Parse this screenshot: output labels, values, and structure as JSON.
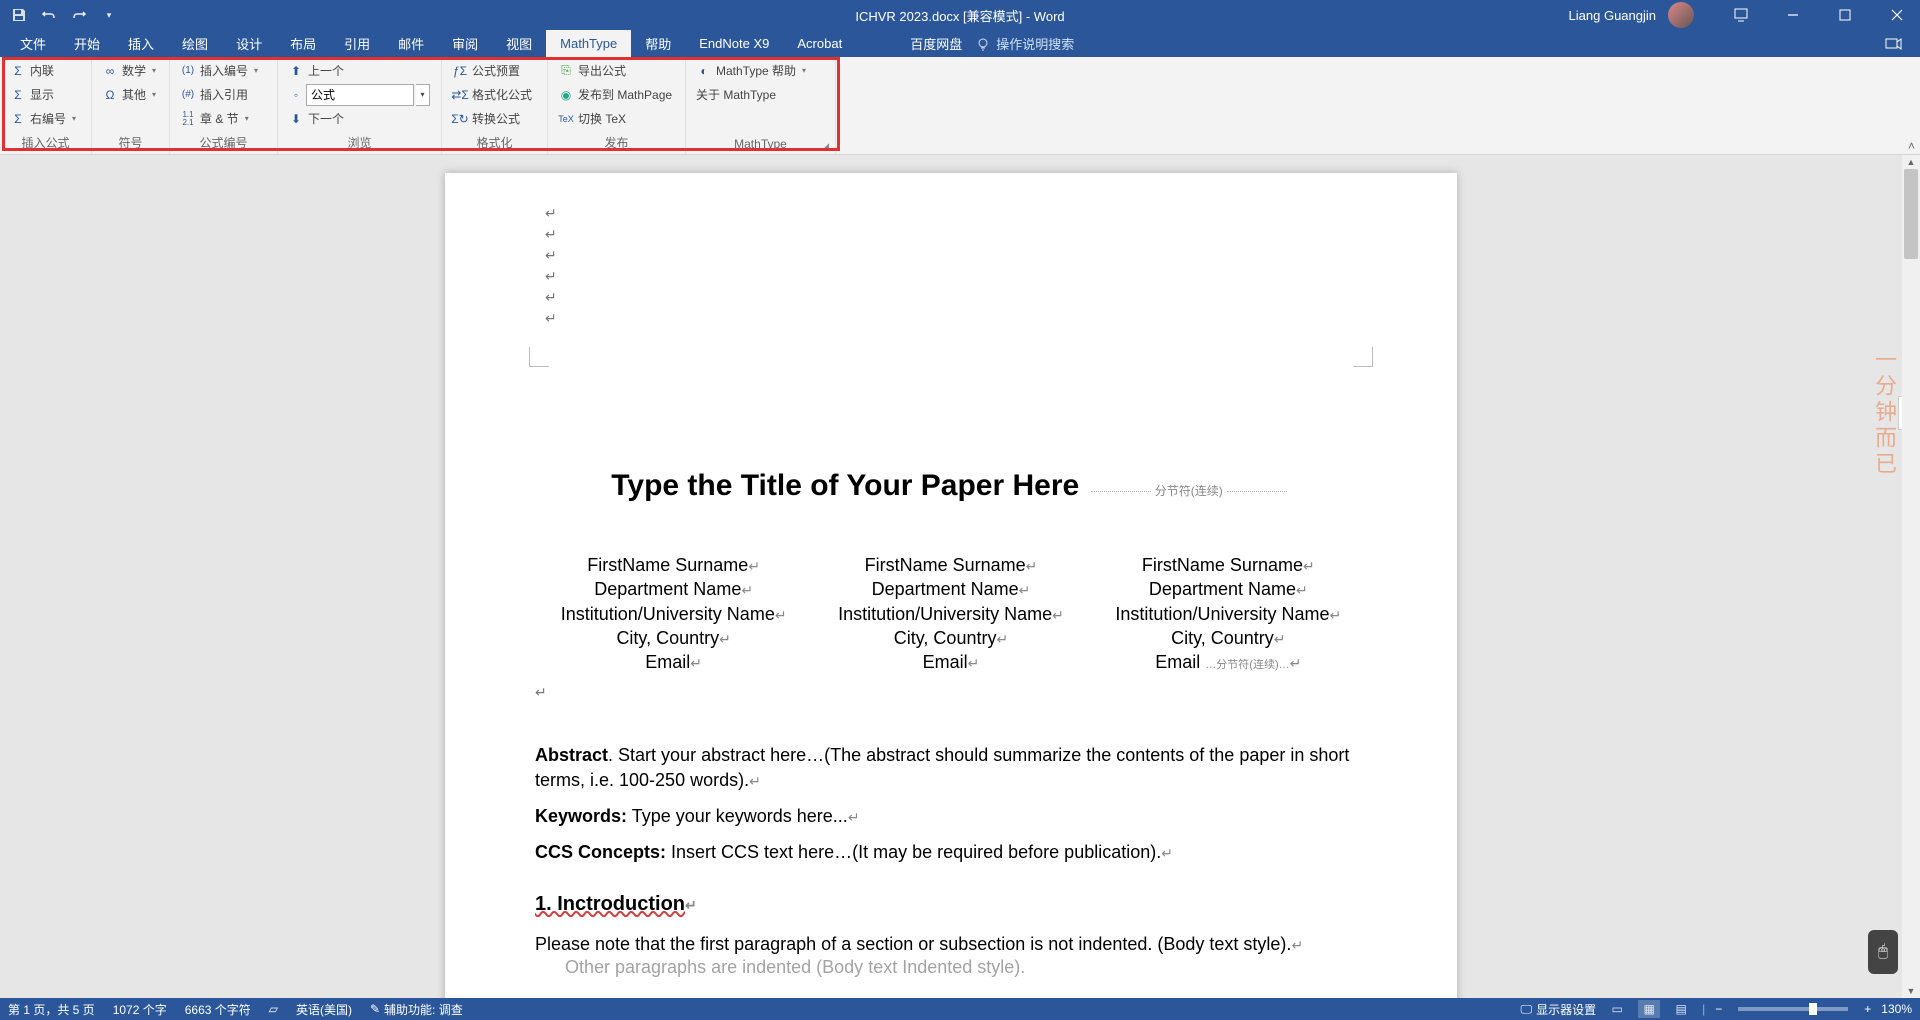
{
  "titlebar": {
    "doc_title": "ICHVR 2023.docx [兼容模式] - Word",
    "user": "Liang Guangjin"
  },
  "tabs": {
    "file": "文件",
    "home": "开始",
    "insert": "插入",
    "draw": "绘图",
    "design": "设计",
    "layout": "布局",
    "references": "引用",
    "mail": "邮件",
    "review": "审阅",
    "view": "视图",
    "mathtype": "MathType",
    "help": "帮助",
    "endnote": "EndNote X9",
    "acrobat": "Acrobat",
    "baidu": "百度网盘",
    "tell_me": "操作说明搜索"
  },
  "ribbon": {
    "g1": {
      "label": "插入公式",
      "inline": "内联",
      "display": "显示",
      "right_num": "右编号"
    },
    "g2": {
      "label": "符号",
      "math": "数学",
      "other": "其他"
    },
    "g3": {
      "label": "公式编号",
      "insert_num": "插入编号",
      "insert_ref": "插入引用",
      "chap_sec": "章 & 节"
    },
    "g4": {
      "label": "浏览",
      "prev": "上一个",
      "formula_value": "公式",
      "next": "下一个"
    },
    "g5": {
      "label": "格式化",
      "preset": "公式预置",
      "format": "格式化公式",
      "convert": "转换公式"
    },
    "g6": {
      "label": "发布",
      "export": "导出公式",
      "mathpage": "发布到 MathPage",
      "tex": "切换 TeX"
    },
    "g7": {
      "label": "MathType",
      "help": "MathType 帮助",
      "about": "关于 MathType"
    }
  },
  "document": {
    "title": "Type the Title of Your Paper Here",
    "section_break": "分节符(连续)",
    "author1": "FirstName Surname",
    "dept": "Department Name",
    "inst": "Institution/University Name",
    "city": "City, Country",
    "email": "Email",
    "abstract_label": "Abstract",
    "abstract_text": ". Start your abstract here…(The abstract should summarize the contents of the paper in short terms, i.e. 100-250 words).",
    "keywords_label": "Keywords:",
    "keywords_text": " Type your keywords here...",
    "ccs_label": "CCS Concepts:",
    "ccs_text": " Insert CCS text here…(It may be required before publication).",
    "h1": "1.  Inctroduction",
    "p1": "Please note that the first paragraph of a section or subsection is not indented. (Body text style).",
    "p2": "Other paragraphs are indented (Body text Indented style)."
  },
  "status": {
    "page": "第 1 页，共 5 页",
    "words": "1072 个字",
    "chars": "6663 个字符",
    "lang": "英语(美国)",
    "a11y": "辅助功能: 调查",
    "display": "显示器设置",
    "zoom": "130%"
  },
  "watermark": "一分钟而已"
}
